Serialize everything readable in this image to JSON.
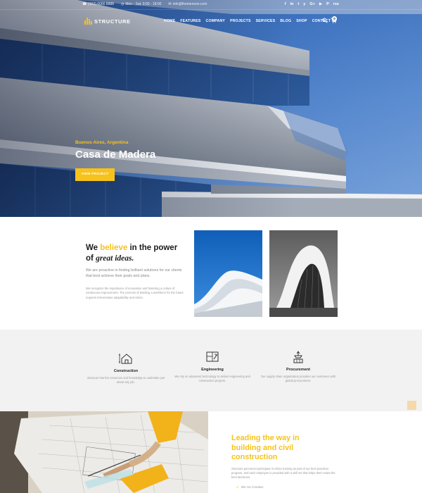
{
  "topbar": {
    "phone": "(102) 6666 8888",
    "hours": "Mon - Sat: 9:00 - 18:00",
    "email": "info@themenove.com",
    "social": [
      "f",
      "in",
      "t",
      "y",
      "G+",
      "▶",
      "P",
      "rss"
    ]
  },
  "nav": {
    "logo": "STRUCTURE",
    "menu": [
      "HOME",
      "FEATURES",
      "COMPANY",
      "PROJECTS",
      "SERVICES",
      "BLOG",
      "SHOP",
      "CONTACT"
    ],
    "cart_count": "0"
  },
  "hero": {
    "location": "Buenos Aires, Argentina",
    "title": "Casa de Madera",
    "button": "VIEW PROJECT"
  },
  "about": {
    "h_pre": "We",
    "h_highlight": "believe",
    "h_post": "in the power",
    "h_line2_pre": "of",
    "h_line2_em": "great ideas.",
    "lead": "We are proactive in finding brilliant solutions for our clients that best achieve their goals and plans.",
    "body": "We recognize the importance of innovation and fostering a culture of continuous improvement. The process of building a workforce for the future requires tremendous adaptability and vision."
  },
  "services": [
    {
      "title": "Construction",
      "desc": "Structure has the resources and knowledge to undertake just about any job.",
      "icon": "house-plan-icon"
    },
    {
      "title": "Engineering",
      "desc": "We rely on advanced technology to deliver engineering and construction projects.",
      "icon": "blueprint-icon"
    },
    {
      "title": "Procurement",
      "desc": "Our supply chain organization provides our customers with global procurement.",
      "icon": "crane-hook-icon"
    }
  ],
  "leading": {
    "title": "Leading the way in building and civil construction",
    "text": "Structure personnel participate in ethics training as part of our best practices program, and each employee is provided with a skill set that helps them make the best decisions.",
    "check": "We Are Creative"
  },
  "colors": {
    "accent": "#f7c21b",
    "dark": "#1b1b1b",
    "muted": "#999999",
    "light_bg": "#f2f2f2"
  }
}
